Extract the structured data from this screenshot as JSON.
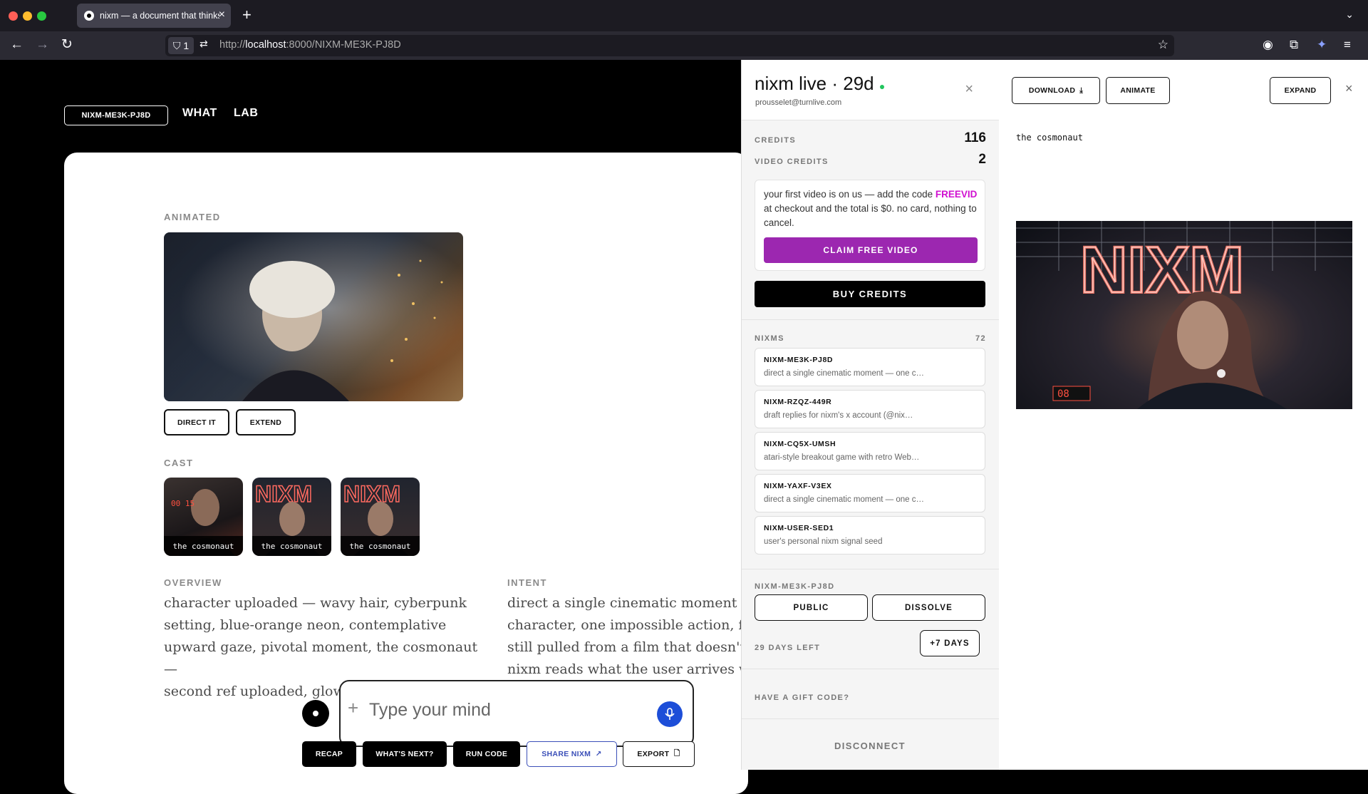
{
  "browser": {
    "tab_title": "nixm — a document that thinks",
    "tab_count": "1",
    "url_prefix": "http://",
    "url_host": "localhost",
    "url_rest": ":8000/NIXM-ME3K-PJ8D"
  },
  "header": {
    "doc_id": "NIXM-ME3K-PJ8D",
    "nav": [
      "WHAT",
      "LAB"
    ]
  },
  "main": {
    "animated_label": "ANIMATED",
    "direct_label": "DIRECT IT",
    "extend_label": "EXTEND",
    "cast_label": "CAST",
    "cast": [
      "the cosmonaut",
      "the cosmonaut",
      "the cosmonaut"
    ],
    "overview_label": "OVERVIEW",
    "overview_lines": [
      "character uploaded — wavy hair, cyberpunk",
      "setting, blue-orange neon, contemplative",
      "upward gaze, pivotal moment, the cosmonaut —",
      "second ref uploaded, glowing blue eyes, dark…"
    ],
    "intent_label": "INTENT",
    "intent_lines": [
      "direct a single cinematic moment —",
      "character, one impossible action, fr",
      "still pulled from a film that doesn't",
      "nixm reads what the user arrives w"
    ],
    "composer_placeholder": "Type your mind",
    "actions": [
      "RECAP",
      "WHAT'S NEXT?",
      "RUN CODE",
      "SHARE NIXM",
      "EXPORT"
    ]
  },
  "account": {
    "title": "nixm live · 29d",
    "email": "prousselet@turnlive.com",
    "credits_label": "CREDITS",
    "credits": "116",
    "video_credits_label": "VIDEO CREDITS",
    "video_credits": "2",
    "promo_before": "your first video is on us — add the code ",
    "promo_code": "FREEVID",
    "promo_after": " at checkout and the total is $0. no card, nothing to cancel.",
    "claim_label": "CLAIM FREE VIDEO",
    "buy_label": "BUY CREDITS",
    "nixms_label": "NIXMS",
    "nixms_count": "72",
    "nixms": [
      {
        "id": "NIXM-ME3K-PJ8D",
        "desc": "direct a single cinematic moment — one c…"
      },
      {
        "id": "NIXM-RZQZ-449R",
        "desc": "draft replies for nixm's x account (@nix…"
      },
      {
        "id": "NIXM-CQ5X-UMSH",
        "desc": "atari-style breakout game with retro Web…"
      },
      {
        "id": "NIXM-YAXF-V3EX",
        "desc": "direct a single cinematic moment — one c…"
      },
      {
        "id": "NIXM-USER-SED1",
        "desc": "user's personal nixm signal seed"
      }
    ],
    "current_id": "NIXM-ME3K-PJ8D",
    "public_label": "PUBLIC",
    "dissolve_label": "DISSOLVE",
    "days_left": "29 DAYS LEFT",
    "extend_days": "+7 DAYS",
    "gift_label": "HAVE A GIFT CODE?",
    "disconnect_label": "DISCONNECT"
  },
  "preview": {
    "download_label": "DOWNLOAD",
    "animate_label": "ANIMATE",
    "expand_label": "EXPAND",
    "caption": "the cosmonaut"
  },
  "colors": {
    "accent_purple": "#9c27b0",
    "promo_code": "#d010d0",
    "live_dot": "#22c55e",
    "mic_blue": "#1d4ed8",
    "share_blue": "#3b4fb8"
  }
}
